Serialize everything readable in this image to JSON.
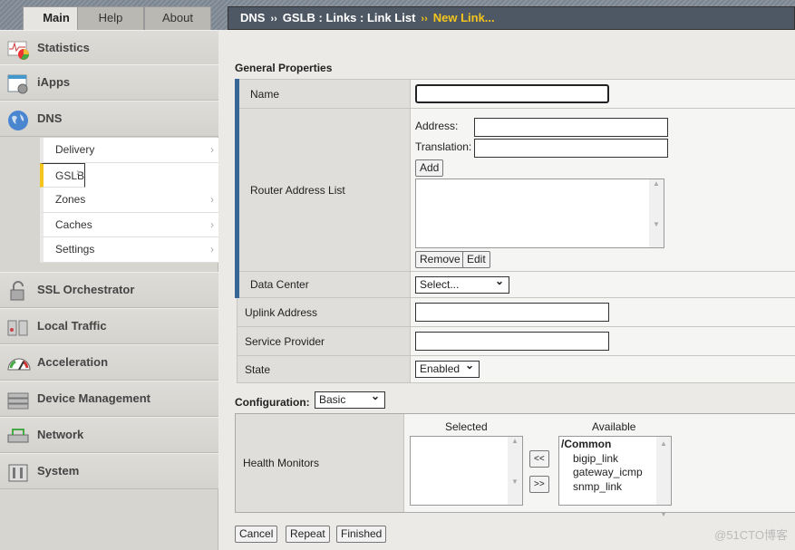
{
  "tabs": [
    "Main",
    "Help",
    "About"
  ],
  "breadcrumb": {
    "parts": [
      "DNS",
      "GSLB : Links : Link List"
    ],
    "current": "New Link...",
    "sep": "››"
  },
  "sidebar": {
    "items": [
      {
        "label": "Statistics",
        "icon": "statistics-icon"
      },
      {
        "label": "iApps",
        "icon": "iapps-icon"
      },
      {
        "label": "DNS",
        "icon": "globe-icon"
      },
      {
        "label": "SSL Orchestrator",
        "icon": "lock-icon"
      },
      {
        "label": "Local Traffic",
        "icon": "local-traffic-icon"
      },
      {
        "label": "Acceleration",
        "icon": "gauge-icon"
      },
      {
        "label": "Device Management",
        "icon": "device-icon"
      },
      {
        "label": "Network",
        "icon": "network-icon"
      },
      {
        "label": "System",
        "icon": "system-icon"
      }
    ],
    "dns_sub": [
      "Delivery",
      "GSLB",
      "Zones",
      "Caches",
      "Settings"
    ],
    "selected_sub": "GSLB"
  },
  "form": {
    "section": "General Properties",
    "name_label": "Name",
    "name_value": "",
    "router_label": "Router Address List",
    "address_label": "Address:",
    "translation_label": "Translation:",
    "add": "Add",
    "remove": "Remove",
    "edit": "Edit",
    "dc_label": "Data Center",
    "dc_value": "Select...",
    "uplink_label": "Uplink Address",
    "sp_label": "Service Provider",
    "state_label": "State",
    "state_value": "Enabled",
    "config_label": "Configuration:",
    "config_value": "Basic",
    "hm_label": "Health Monitors",
    "selected": "Selected",
    "available": "Available",
    "move_left": "<<",
    "move_right": ">>",
    "available_group": "/Common",
    "available_items": [
      "bigip_link",
      "gateway_icmp",
      "snmp_link"
    ]
  },
  "buttons": {
    "cancel": "Cancel",
    "repeat": "Repeat",
    "finished": "Finished"
  },
  "watermark": "@51CTO博客"
}
